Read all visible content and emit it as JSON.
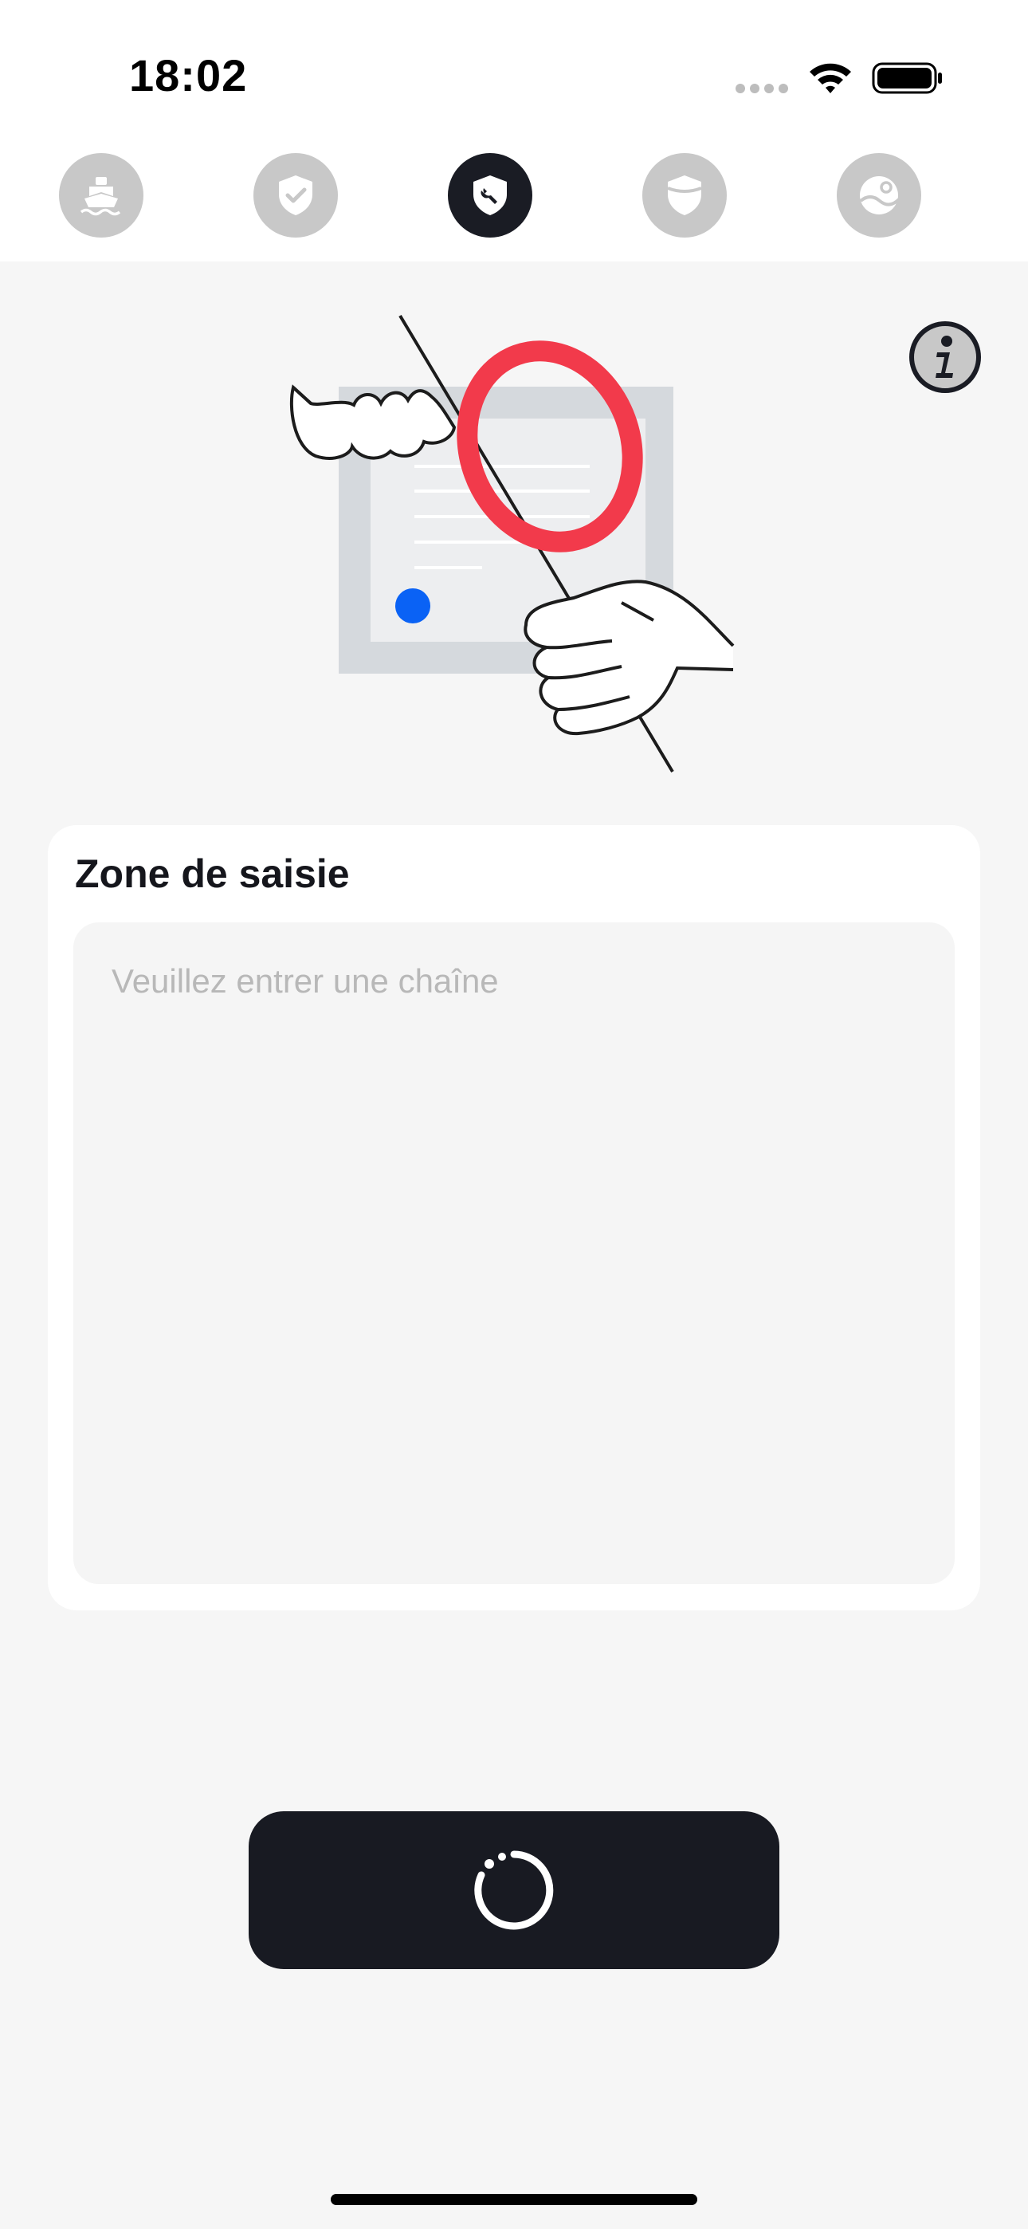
{
  "status_bar": {
    "time": "18:02"
  },
  "tabs": [
    {
      "icon": "ship-icon",
      "active": false
    },
    {
      "icon": "shield-check-icon",
      "active": false
    },
    {
      "icon": "shield-wrench-icon",
      "active": true
    },
    {
      "icon": "shield-half-icon",
      "active": false
    },
    {
      "icon": "landscape-photo-icon",
      "active": false
    }
  ],
  "input_card": {
    "title": "Zone de saisie",
    "placeholder": "Veuillez entrer une chaîne",
    "value": ""
  },
  "action_button": {
    "icon": "loading-spinner-icon"
  },
  "colors": {
    "background": "#f6f6f6",
    "accent_dark": "#1a1c24",
    "tab_inactive": "#c8c8c8",
    "highlight_red": "#f23a4b",
    "dot_blue": "#0a62f5"
  }
}
